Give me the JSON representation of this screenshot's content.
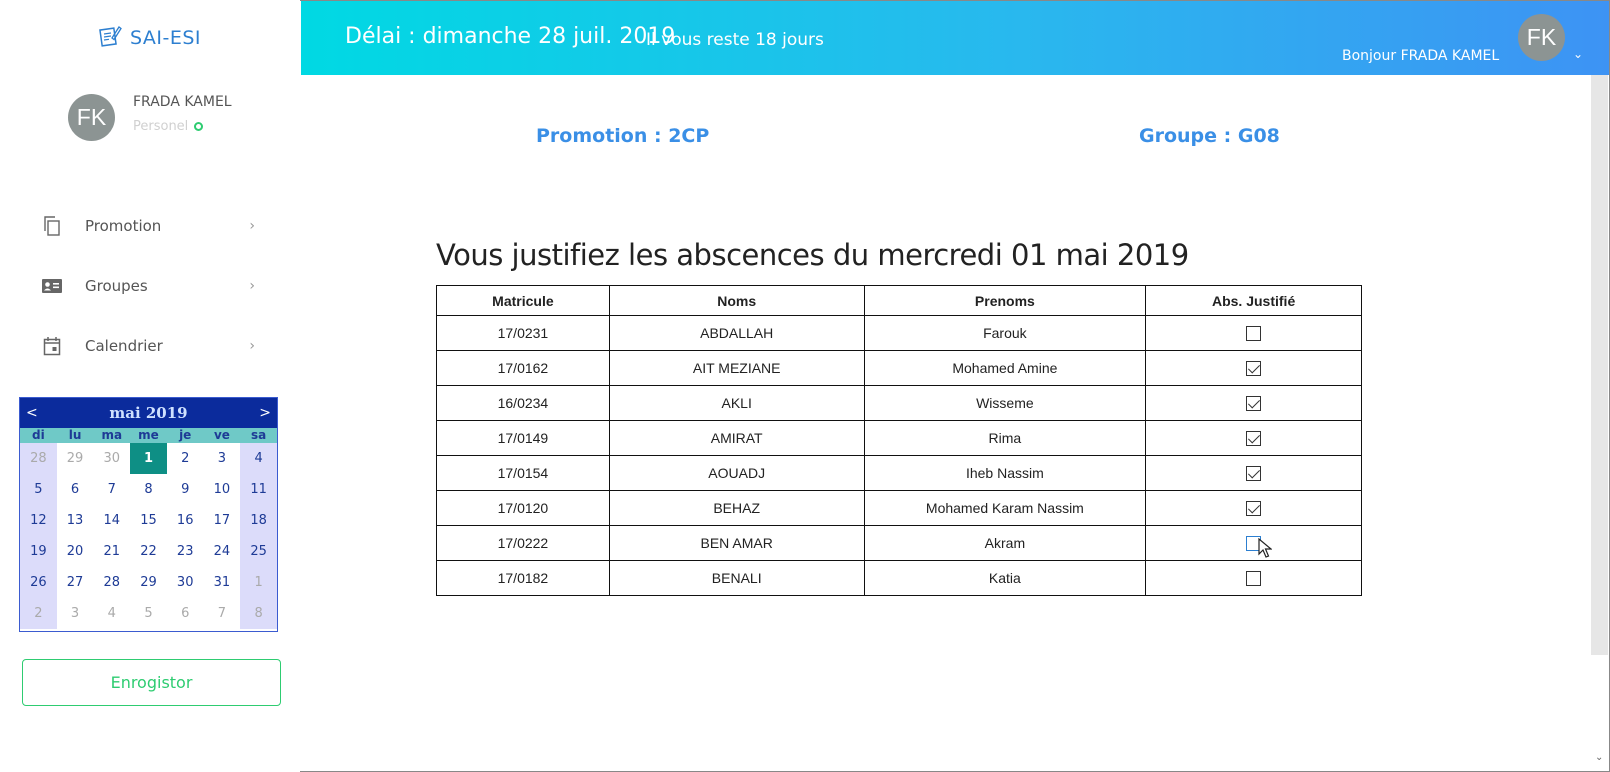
{
  "brand": {
    "name": "SAI-ESI",
    "icon": "document-pencil-icon"
  },
  "user": {
    "initials": "FK",
    "name": "FRADA KAMEL",
    "role": "Personel"
  },
  "nav": [
    {
      "label": "Promotion",
      "icon": "copy-icon"
    },
    {
      "label": "Groupes",
      "icon": "id-card-icon"
    },
    {
      "label": "Calendrier",
      "icon": "calendar-icon"
    }
  ],
  "calendar": {
    "title": "mai 2019",
    "prev": "<",
    "next": ">",
    "dows": [
      "di",
      "lu",
      "ma",
      "me",
      "je",
      "ve",
      "sa"
    ],
    "weeks": [
      [
        "28",
        "29",
        "30",
        "1",
        "2",
        "3",
        "4"
      ],
      [
        "5",
        "6",
        "7",
        "8",
        "9",
        "10",
        "11"
      ],
      [
        "12",
        "13",
        "14",
        "15",
        "16",
        "17",
        "18"
      ],
      [
        "19",
        "20",
        "21",
        "22",
        "23",
        "24",
        "25"
      ],
      [
        "26",
        "27",
        "28",
        "29",
        "30",
        "31",
        "1"
      ],
      [
        "2",
        "3",
        "4",
        "5",
        "6",
        "7",
        "8"
      ]
    ],
    "selected": "1"
  },
  "save_label": "Enrogistor",
  "header": {
    "deadline": "Délai : dimanche 28 juil. 2019",
    "remaining": "Il vous reste 18 jours",
    "greeting": "Bonjour FRADA KAMEL",
    "avatar_initials": "FK",
    "chevron": "⌄"
  },
  "promotion": "Promotion : 2CP",
  "groupe": "Groupe : G08",
  "title": "Vous justifiez les abscences du mercredi 01 mai 2019",
  "table": {
    "headers": [
      "Matricule",
      "Noms",
      "Prenoms",
      "Abs. Justifié"
    ],
    "rows": [
      {
        "matricule": "17/0231",
        "nom": "ABDALLAH",
        "prenom": "Farouk",
        "justifie": false
      },
      {
        "matricule": "17/0162",
        "nom": "AIT MEZIANE",
        "prenom": "Mohamed Amine",
        "justifie": true
      },
      {
        "matricule": "16/0234",
        "nom": "AKLI",
        "prenom": "Wisseme",
        "justifie": true
      },
      {
        "matricule": "17/0149",
        "nom": "AMIRAT",
        "prenom": "Rima",
        "justifie": true
      },
      {
        "matricule": "17/0154",
        "nom": "AOUADJ",
        "prenom": "Iheb Nassim",
        "justifie": true
      },
      {
        "matricule": "17/0120",
        "nom": "BEHAZ",
        "prenom": "Mohamed Karam Nassim",
        "justifie": true
      },
      {
        "matricule": "17/0222",
        "nom": "BEN AMAR",
        "prenom": "Akram",
        "justifie": false
      },
      {
        "matricule": "17/0182",
        "nom": "BENALI",
        "prenom": "Katia",
        "justifie": false
      }
    ]
  },
  "colors": {
    "accent": "#3a8fe6",
    "success": "#2ecc71",
    "header_start": "#00d9e3",
    "header_end": "#3d93f4"
  }
}
